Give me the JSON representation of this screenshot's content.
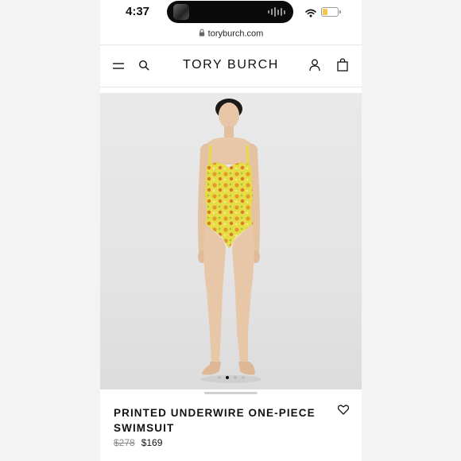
{
  "status_bar": {
    "time": "4:37"
  },
  "browser": {
    "url": "toryburch.com"
  },
  "header": {
    "brand": "TORY BURCH"
  },
  "gallery": {
    "image_count": 4,
    "active_index": 1,
    "swimsuit_color": "#e8df4a"
  },
  "product": {
    "title": "PRINTED UNDERWIRE ONE-PIECE SWIMSUIT",
    "original_price": "$278",
    "sale_price": "$169"
  }
}
